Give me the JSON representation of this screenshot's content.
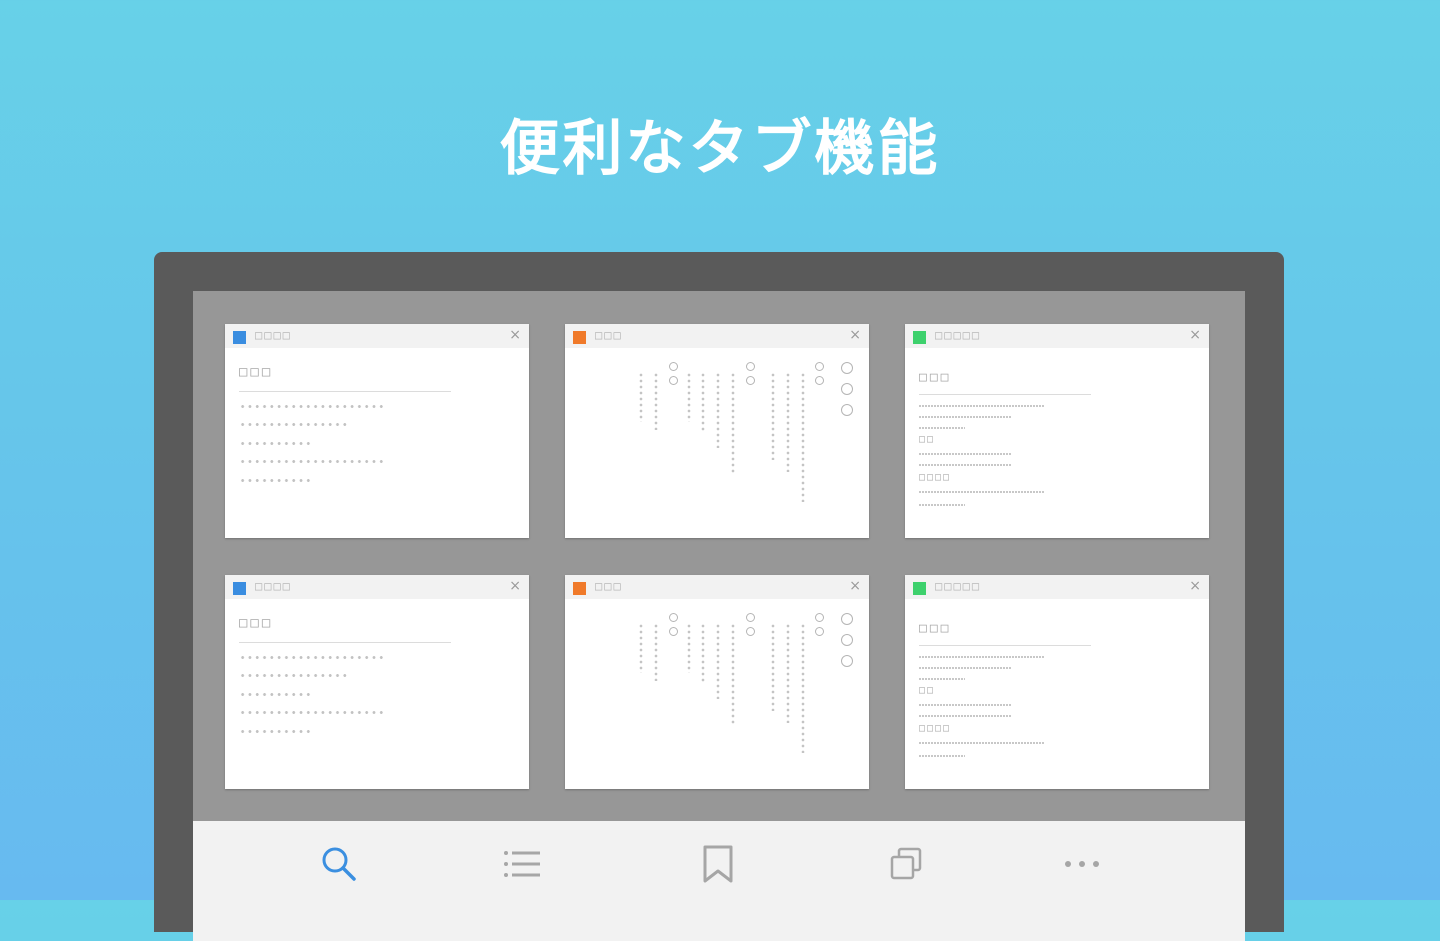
{
  "headline": "便利なタブ機能",
  "colors": {
    "accent": "#3b8fe0",
    "favicon_blue": "#3a8de0",
    "favicon_orange": "#f07a2a",
    "favicon_green": "#3ed16d",
    "toolbar_icon": "#a6a6a6"
  },
  "tabs": [
    {
      "title": "□□□□",
      "favicon_color": "blue",
      "content_style": "article",
      "heading": "□□□"
    },
    {
      "title": "□□□",
      "favicon_color": "orange",
      "content_style": "vertical-text",
      "heading": ""
    },
    {
      "title": "□□□□□",
      "favicon_color": "green",
      "content_style": "list",
      "heading": "□□□",
      "sub1": "□□",
      "sub2": "□□□□"
    },
    {
      "title": "□□□□",
      "favicon_color": "blue",
      "content_style": "article",
      "heading": "□□□"
    },
    {
      "title": "□□□",
      "favicon_color": "orange",
      "content_style": "vertical-text",
      "heading": ""
    },
    {
      "title": "□□□□□",
      "favicon_color": "green",
      "content_style": "list",
      "heading": "□□□",
      "sub1": "□□",
      "sub2": "□□□□"
    }
  ],
  "close_glyph": "×",
  "toolbar": {
    "items": [
      {
        "icon": "search-icon",
        "active": true
      },
      {
        "icon": "list-icon",
        "active": false
      },
      {
        "icon": "bookmark-icon",
        "active": false
      },
      {
        "icon": "tabs-icon",
        "active": false
      },
      {
        "icon": "more-icon",
        "active": false
      }
    ]
  }
}
